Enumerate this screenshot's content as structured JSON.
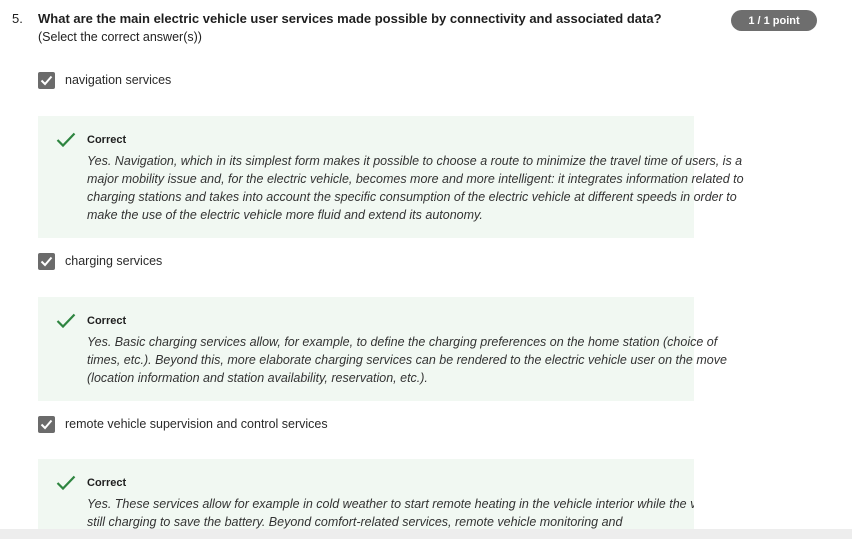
{
  "question": {
    "number": "5.",
    "title": "What are the main electric vehicle user services made possible by connectivity and associated data?",
    "subtitle": "(Select the correct answer(s))",
    "points": "1 / 1 point"
  },
  "options": [
    {
      "label": "navigation services",
      "checked": true,
      "feedback_status": "Correct",
      "feedback_text": "Yes. Navigation, which in its simplest form makes it possible to choose a route to minimize the travel time of users, is a major mobility issue and, for the electric vehicle, becomes more and more intelligent: it integrates information related to charging stations and takes into account the specific consumption of the electric vehicle at different speeds in order to make the use of the electric vehicle more fluid and extend its autonomy."
    },
    {
      "label": "charging services",
      "checked": true,
      "feedback_status": "Correct",
      "feedback_text": "Yes. Basic charging services allow, for example, to define the charging preferences on the home station (choice of times, etc.). Beyond this, more elaborate charging services can be rendered to the electric vehicle user on the move (location information and station availability, reservation, etc.)."
    },
    {
      "label": "remote vehicle supervision and control services",
      "checked": true,
      "feedback_status": "Correct",
      "feedback_text": "Yes. These services allow for example in cold weather to start remote heating in the vehicle interior while the vehicle is still charging to save the battery. Beyond comfort-related services, remote vehicle monitoring and"
    }
  ],
  "colors": {
    "badge": "#6e6e6e",
    "checkbox": "#6b6b6b",
    "feedback_bg": "#f1f8f2",
    "correct_green": "#2e8540"
  },
  "icons": {
    "checkbox": "checkmark-icon",
    "feedback": "correct-check-icon"
  }
}
